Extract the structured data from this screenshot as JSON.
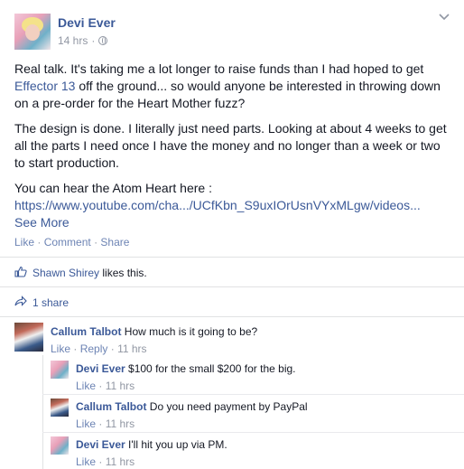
{
  "post": {
    "author": "Devi Ever",
    "time": "14 hrs",
    "meta_sep": "·",
    "paragraphs": {
      "p1_a": "Real talk. It's taking me a lot longer to raise funds than I had hoped to get ",
      "p1_link": "Effector 13",
      "p1_b": " off the ground... so would anyone be interested in throwing down on a pre-order for the Heart Mother fuzz?",
      "p2": "The design is done. I literally just need parts. Looking at about 4 weeks to get all the parts I need once I have the money and no longer than a week or two to start production.",
      "p3": "You can hear the Atom Heart here :",
      "url": "https://www.youtube.com/cha.../UCfKbn_S9uxIOrUsnVYxMLgw/videos...",
      "see_more": "See More"
    },
    "actions": {
      "like": "Like",
      "comment": "Comment",
      "share": "Share",
      "sep": "·"
    },
    "likes": {
      "name": "Shawn Shirey",
      "text": " likes this."
    },
    "shares": {
      "text": "1 share"
    }
  },
  "comments": [
    {
      "name": "Callum Talbot",
      "text": " How much is it going to be?",
      "like": "Like",
      "reply": "Reply",
      "time": "11 hrs",
      "sep": "·"
    }
  ],
  "replies": [
    {
      "name": "Devi Ever",
      "text": " $100 for the small $200 for the big.",
      "like": "Like",
      "time": "11 hrs",
      "sep": "·"
    },
    {
      "name": "Callum Talbot",
      "text": " Do you need payment by PayPal",
      "like": "Like",
      "time": "11 hrs",
      "sep": "·"
    },
    {
      "name": "Devi Ever",
      "text": " I'll hit you up via PM.",
      "like": "Like",
      "time": "11 hrs",
      "sep": "·"
    }
  ],
  "colors": {
    "link": "#3b5998",
    "muted": "#9197a3",
    "action": "#6d84b4",
    "text": "#141823"
  },
  "icons": {
    "privacy": "globe-icon",
    "menu": "chevron-down-icon",
    "like": "thumbs-up-icon",
    "share": "share-arrow-icon"
  }
}
